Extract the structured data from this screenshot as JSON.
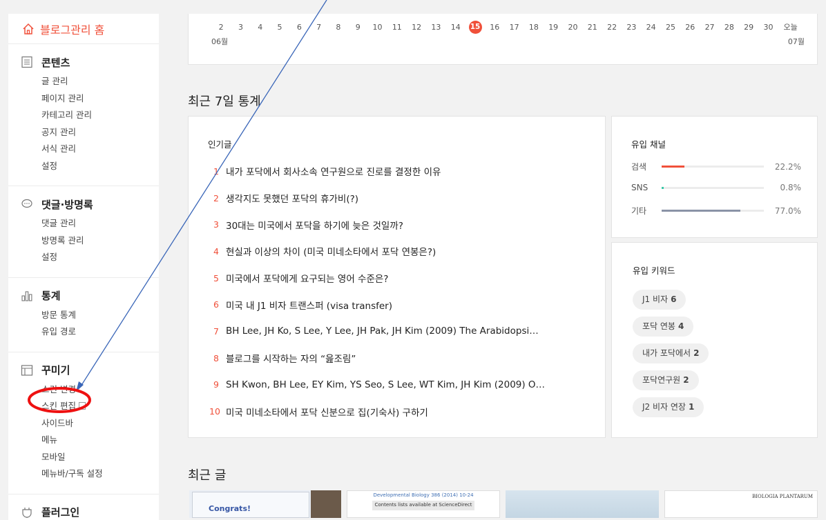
{
  "sidebar": {
    "home_label": "블로그관리 홈",
    "sections": [
      {
        "title": "콘텐츠",
        "icon": "document-icon",
        "items": [
          "글 관리",
          "페이지 관리",
          "카테고리 관리",
          "공지 관리",
          "서식 관리",
          "설정"
        ]
      },
      {
        "title": "댓글·방명록",
        "icon": "comment-icon",
        "items": [
          "댓글 관리",
          "방명록 관리",
          "설정"
        ]
      },
      {
        "title": "통계",
        "icon": "bar-chart-icon",
        "items": [
          "방문 통계",
          "유입 경로"
        ]
      },
      {
        "title": "꾸미기",
        "icon": "layout-icon",
        "items": [
          "스킨 변경",
          "스킨 편집",
          "사이드바",
          "메뉴",
          "모바일",
          "메뉴바/구독 설정"
        ]
      },
      {
        "title": "플러그인",
        "icon": "plugin-icon",
        "items": []
      }
    ]
  },
  "timeline": {
    "days": [
      "2",
      "3",
      "4",
      "5",
      "6",
      "7",
      "8",
      "9",
      "10",
      "11",
      "12",
      "13",
      "14",
      "15",
      "16",
      "17",
      "18",
      "19",
      "20",
      "21",
      "22",
      "23",
      "24",
      "25",
      "26",
      "27",
      "28",
      "29",
      "30",
      "오늘"
    ],
    "active_day": "15",
    "month_start": "06월",
    "month_end": "07월"
  },
  "stats": {
    "heading": "최근 7일 통계",
    "popular": {
      "title": "인기글",
      "posts": [
        {
          "rank": "1",
          "title": "내가 포닥에서 회사소속 연구원으로 진로를 결정한 이유"
        },
        {
          "rank": "2",
          "title": "생각지도 못했던 포닥의 휴가비(?)"
        },
        {
          "rank": "3",
          "title": "30대는 미국에서 포닥을 하기에 늦은 것일까?"
        },
        {
          "rank": "4",
          "title": "현실과 이상의 차이 (미국 미네소타에서 포닥 연봉은?)"
        },
        {
          "rank": "5",
          "title": "미국에서 포닥에게 요구되는 영어 수준은?"
        },
        {
          "rank": "6",
          "title": "미국 내 J1 비자 트랜스퍼 (visa transfer)"
        },
        {
          "rank": "7",
          "title": "BH Lee, JH Ko, S Lee, Y Lee, JH Pak, JH Kim (2009) The Arabidopsi…"
        },
        {
          "rank": "8",
          "title": "블로그를 시작하는 자의 “읊조림”"
        },
        {
          "rank": "9",
          "title": "SH Kwon, BH Lee, EY Kim, YS Seo, S Lee, WT Kim, JH Kim (2009) O…"
        },
        {
          "rank": "10",
          "title": "미국 미네소타에서 포닥 신분으로 집(기숙사) 구하기"
        }
      ]
    },
    "channels": {
      "title": "유입 채널",
      "rows": [
        {
          "name": "검색",
          "pct": "22.2%",
          "value": 22.2,
          "color": "#f0503a"
        },
        {
          "name": "SNS",
          "pct": "0.8%",
          "value": 0.8,
          "color": "#3cc8a8"
        },
        {
          "name": "기타",
          "pct": "77.0%",
          "value": 77.0,
          "color": "#8a93a6"
        }
      ]
    },
    "keywords": {
      "title": "유입 키워드",
      "items": [
        {
          "label": "J1 비자",
          "count": "6"
        },
        {
          "label": "포닥 연봉",
          "count": "4"
        },
        {
          "label": "내가 포닥에서",
          "count": "2"
        },
        {
          "label": "포닥연구원",
          "count": "2"
        },
        {
          "label": "J2 비자 연장",
          "count": "1"
        }
      ]
    }
  },
  "recent": {
    "heading": "최근 글",
    "thumb_texts": [
      "Congrats!",
      "Developmental Biology 386 (2014) 10-24",
      "Contents lists available at ScienceDirect",
      "BIOLOGIA PLANTARUM"
    ]
  },
  "colors": {
    "accent": "#f0503a",
    "annotation_line": "#3a66b8",
    "annotation_circle": "#e11"
  }
}
